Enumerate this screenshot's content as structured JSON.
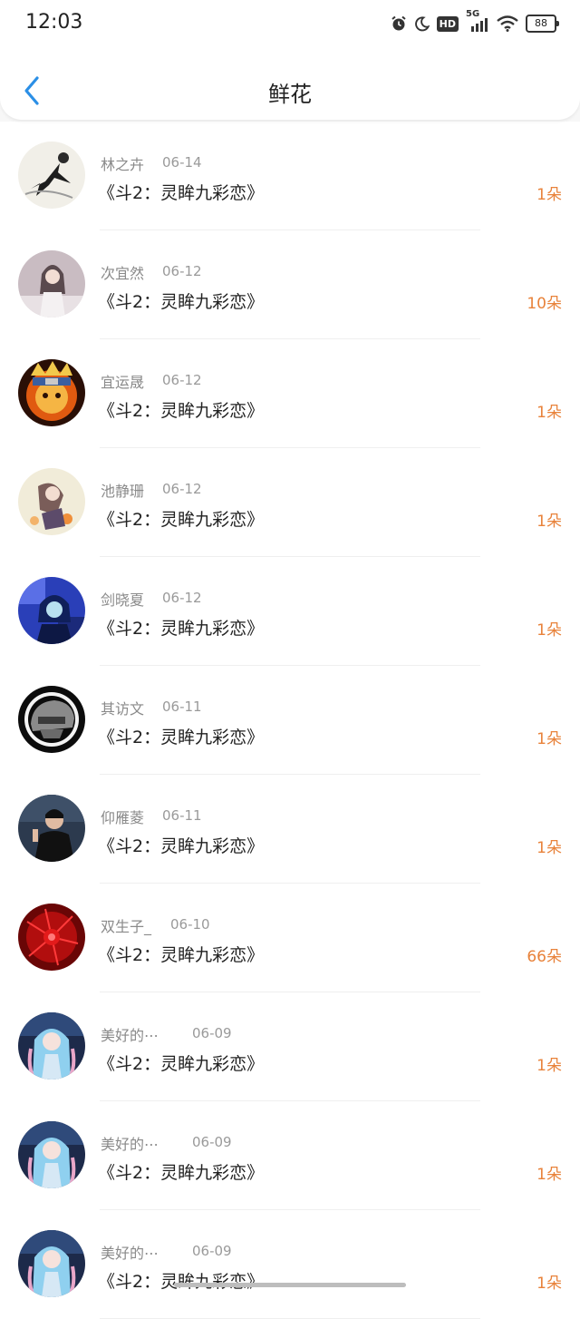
{
  "status_bar": {
    "time": "12:03",
    "network": "5G",
    "hd": "HD",
    "battery": "88"
  },
  "header": {
    "title": "鲜花"
  },
  "colors": {
    "accent_blue": "#2b8fe6",
    "count_orange": "#e8823a"
  },
  "items": [
    {
      "name": "林之卉",
      "date": "06-14",
      "book": "《斗2：灵眸九彩恋》",
      "count": "1朵",
      "avatar": "ink-dancer"
    },
    {
      "name": "次宜然",
      "date": "06-12",
      "book": "《斗2：灵眸九彩恋》",
      "count": "10朵",
      "avatar": "girl-portrait"
    },
    {
      "name": "宜运晟",
      "date": "06-12",
      "book": "《斗2：灵眸九彩恋》",
      "count": "1朵",
      "avatar": "ninja-fire"
    },
    {
      "name": "池静珊",
      "date": "06-12",
      "book": "《斗2：灵眸九彩恋》",
      "count": "1朵",
      "avatar": "doll-flowers"
    },
    {
      "name": "剑晓夏",
      "date": "06-12",
      "book": "《斗2：灵眸九彩恋》",
      "count": "1朵",
      "avatar": "blue-anime"
    },
    {
      "name": "其访文",
      "date": "06-11",
      "book": "《斗2：灵眸九彩恋》",
      "count": "1朵",
      "avatar": "helmet"
    },
    {
      "name": "仰雁菱",
      "date": "06-11",
      "book": "《斗2：灵眸九彩恋》",
      "count": "1朵",
      "avatar": "man-portrait"
    },
    {
      "name": "双生子_",
      "date": "06-10",
      "book": "《斗2：灵眸九彩恋》",
      "count": "66朵",
      "avatar": "red-flower"
    },
    {
      "name": "美好的⋯",
      "date": "06-09",
      "book": "《斗2：灵眸九彩恋》",
      "count": "1朵",
      "avatar": "anime-girl-blue"
    },
    {
      "name": "美好的⋯",
      "date": "06-09",
      "book": "《斗2：灵眸九彩恋》",
      "count": "1朵",
      "avatar": "anime-girl-blue"
    },
    {
      "name": "美好的⋯",
      "date": "06-09",
      "book": "《斗2：灵眸九彩恋》",
      "count": "1朵",
      "avatar": "anime-girl-blue"
    }
  ]
}
